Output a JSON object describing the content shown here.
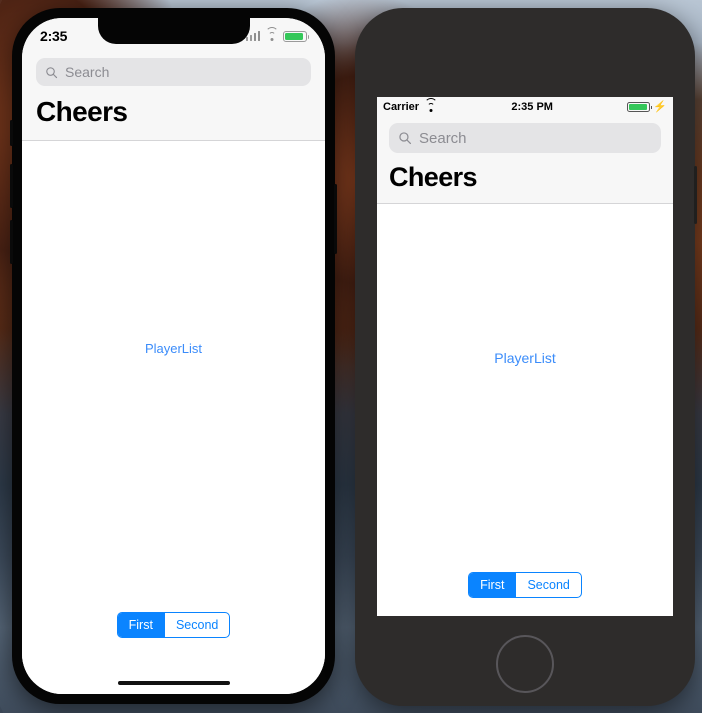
{
  "desktop": {
    "wallpaper_name": "macos-mountain-wallpaper"
  },
  "phones": [
    {
      "id": "iphone-x-simulator",
      "model_style": "iphone-x",
      "status_bar": {
        "time": "2:35",
        "signal_icon": "cellular-signal-icon",
        "wifi_icon": "wifi-icon",
        "battery_icon": "battery-icon"
      },
      "app": {
        "search": {
          "placeholder": "Search",
          "value": "",
          "icon": "search-icon"
        },
        "title": "Cheers",
        "body_link": "PlayerList",
        "segmented_control": {
          "options": [
            "First",
            "Second"
          ],
          "selected_index": 0,
          "accent_color": "#0a84ff"
        }
      },
      "home_indicator": true
    },
    {
      "id": "iphone-8-simulator",
      "model_style": "iphone-8",
      "status_bar": {
        "carrier": "Carrier",
        "wifi_icon": "wifi-icon",
        "time": "2:35 PM",
        "battery_icon": "battery-icon",
        "charging_icon": "lightning-bolt-icon"
      },
      "app": {
        "search": {
          "placeholder": "Search",
          "value": "",
          "icon": "search-icon"
        },
        "title": "Cheers",
        "body_link": "PlayerList",
        "segmented_control": {
          "options": [
            "First",
            "Second"
          ],
          "selected_index": 0,
          "accent_color": "#0a84ff"
        }
      },
      "home_button": true
    }
  ]
}
